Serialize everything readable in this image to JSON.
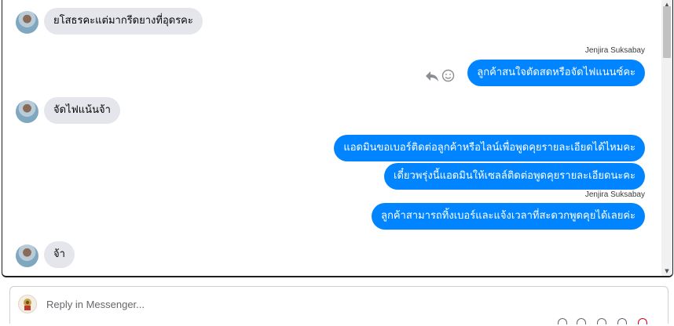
{
  "thread": {
    "messages": [
      {
        "dir": "in",
        "text": "ยโสธรคะแต่มากรีดยางที่อุดรคะ"
      },
      {
        "dir": "out",
        "sender": "Jenjira Suksabay",
        "text": "ลูกค้าสนใจตัดสดหรือจัดไฟแนนซ์คะ"
      },
      {
        "dir": "in",
        "text": "จัดไฟแน้นจ้า"
      },
      {
        "dir": "out",
        "text": "แอดมินขอเบอร์ติดต่อลูกค้าหรือไลน์เพื่อพูดคุยรายละเอียดได้ไหมคะ"
      },
      {
        "dir": "out",
        "text": "เดี๋ยวพรุ่งนี้แอดมินให้เซลล์ติดต่อพูดคุยรายละเอียดนะคะ"
      },
      {
        "dir": "out",
        "sender": "Jenjira Suksabay",
        "text": "ลูกค้าสามารถทิ้งเบอร์และแจ้งเวลาที่สะดวกพูดคุยได้เลยค่ะ"
      },
      {
        "dir": "in",
        "text": "จ้า"
      }
    ]
  },
  "reply": {
    "placeholder": "Reply in Messenger..."
  },
  "colors": {
    "outgoing": "#0084ff",
    "incoming": "#e4e6eb",
    "text": "#050505"
  },
  "icons": [
    "reply-icon",
    "emoji-icon",
    "scroll-up-icon",
    "scroll-down-icon"
  ]
}
